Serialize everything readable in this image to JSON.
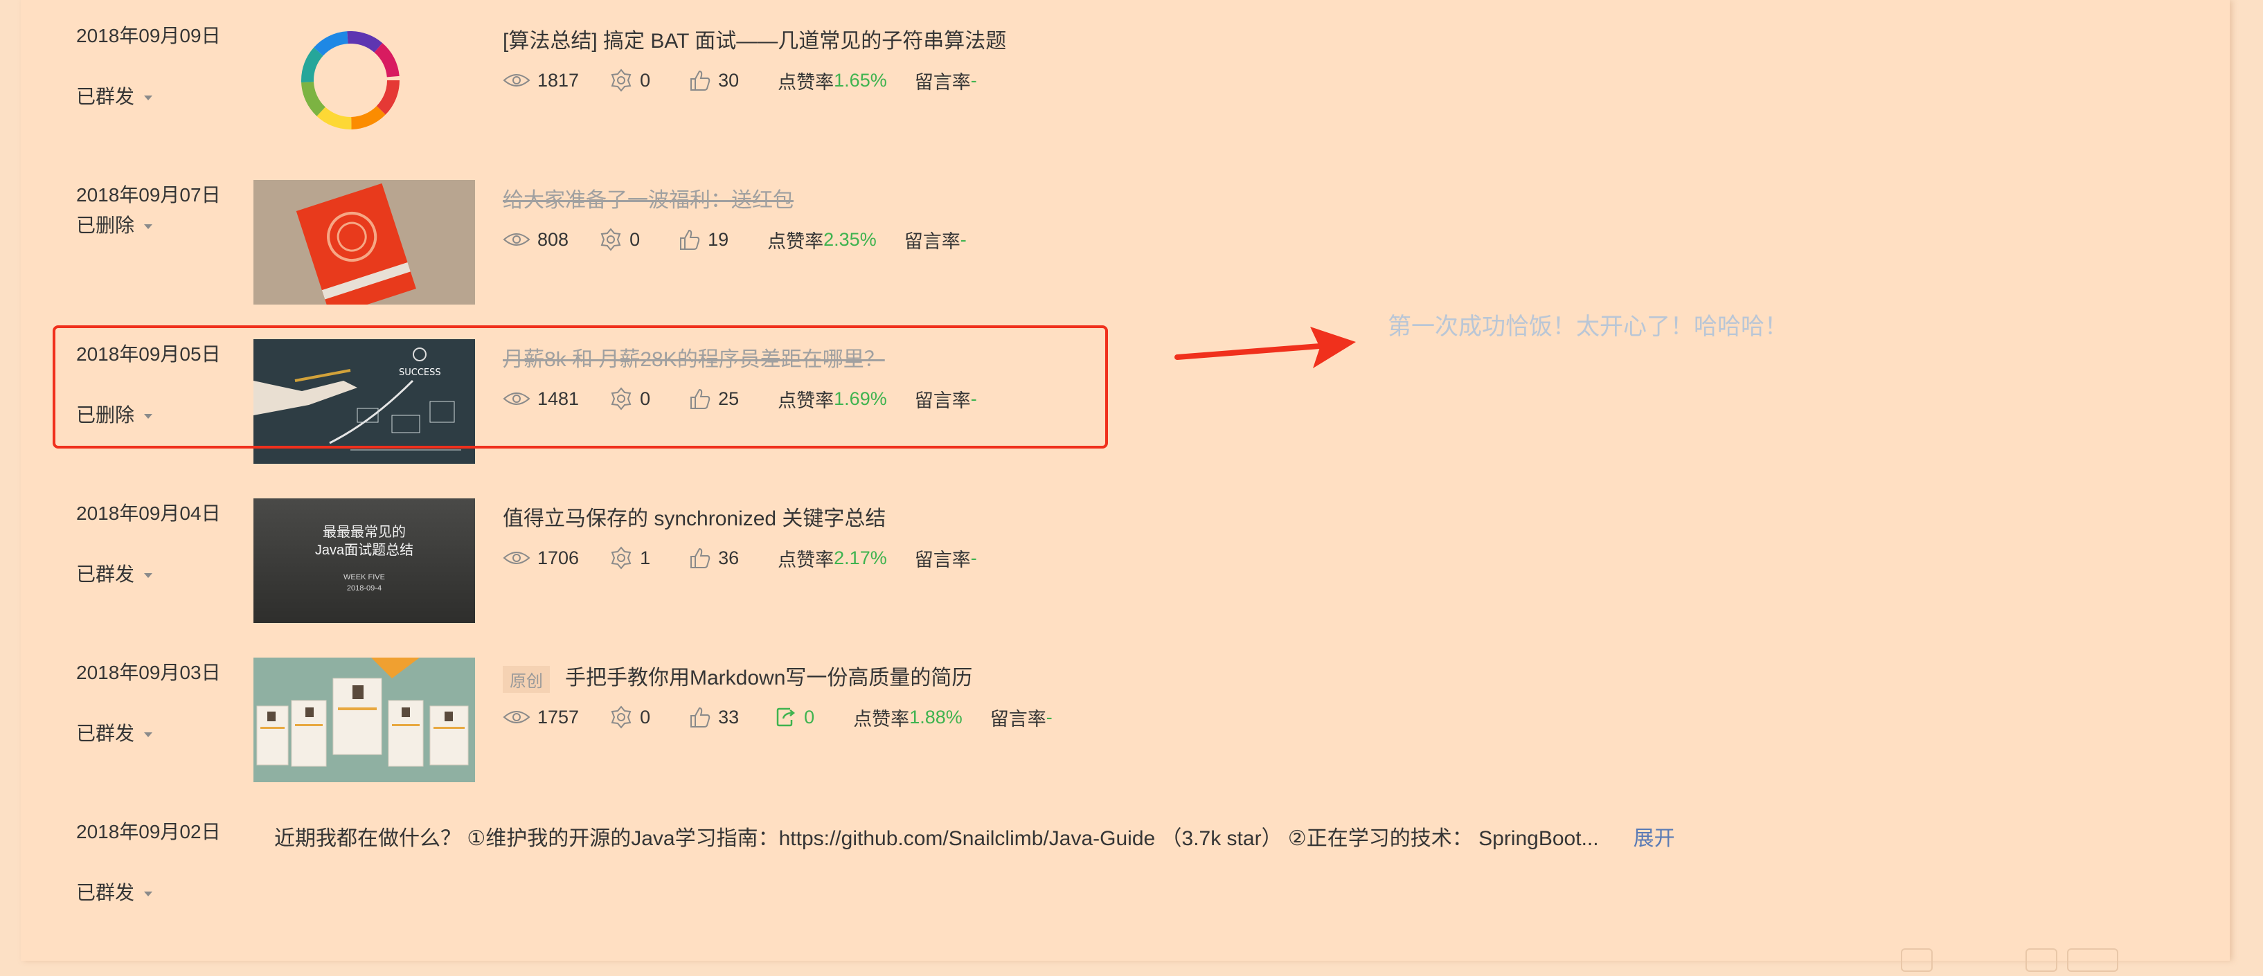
{
  "items": [
    {
      "date": "2018年09月09日",
      "status": "已群发",
      "title": "[算法总结] 搞定 BAT 面试——几道常见的子符串算法题",
      "views": "1817",
      "shares": "0",
      "likes": "30",
      "like_rate_label": "点赞率",
      "like_rate": "1.65%",
      "comment_label": "留言率",
      "comment_rate": "-"
    },
    {
      "date": "2018年09月07日",
      "status": "已删除",
      "title": "给大家准备了一波福利：送红包",
      "views": "808",
      "shares": "0",
      "likes": "19",
      "like_rate_label": "点赞率",
      "like_rate": "2.35%",
      "comment_label": "留言率",
      "comment_rate": "-"
    },
    {
      "date": "2018年09月05日",
      "status": "已删除",
      "title": "月薪8k 和 月薪28K的程序员差距在哪里？",
      "views": "1481",
      "shares": "0",
      "likes": "25",
      "like_rate_label": "点赞率",
      "like_rate": "1.69%",
      "comment_label": "留言率",
      "comment_rate": "-"
    },
    {
      "date": "2018年09月04日",
      "status": "已群发",
      "title": "值得立马保存的 synchronized 关键字总结",
      "views": "1706",
      "shares": "1",
      "likes": "36",
      "like_rate_label": "点赞率",
      "like_rate": "2.17%",
      "comment_label": "留言率",
      "comment_rate": "-",
      "thumb_text_1": "最最最常见的",
      "thumb_text_2": "Java面试题总结",
      "thumb_text_3": "WEEK FIVE",
      "thumb_text_4": "2018-09-4"
    },
    {
      "date": "2018年09月03日",
      "status": "已群发",
      "badge": "原创",
      "title": "手把手教你用Markdown写一份高质量的简历",
      "views": "1757",
      "shares": "0",
      "likes": "33",
      "reposts": "0",
      "like_rate_label": "点赞率",
      "like_rate": "1.88%",
      "comment_label": "留言率",
      "comment_rate": "-"
    },
    {
      "date": "2018年09月02日",
      "status": "已群发",
      "text": "近期我都在做什么？ ①维护我的开源的Java学习指南：https://github.com/Snailclimb/Java-Guide （3.7k star） ②正在学习的技术： SpringBoot...",
      "expand": "展开"
    }
  ],
  "annotation": "第一次成功恰饭！太开心了！哈哈哈！",
  "thumb_success_text": "SUCCESS",
  "colors": {
    "background": "#fce0c5",
    "highlight_border": "#f0301c",
    "arrow": "#f0301c",
    "rate_green": "#3fb34f",
    "annotation_text": "#b9c6d6"
  }
}
